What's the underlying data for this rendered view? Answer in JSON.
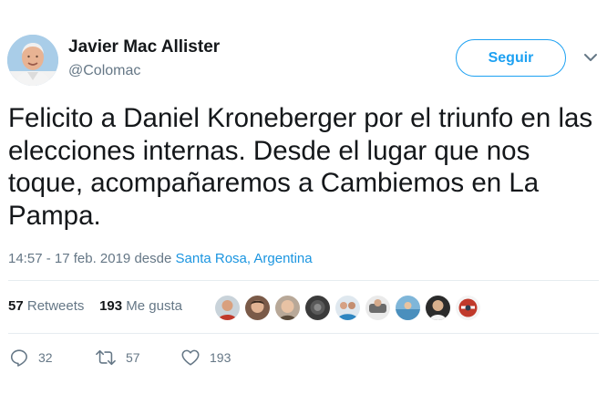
{
  "tweet": {
    "author_name": "Javier Mac Allister",
    "author_handle": "@Colomac",
    "follow_label": "Seguir",
    "text": "Felicito a Daniel Kroneberger por el triunfo en las elecciones internas. Desde el lugar que nos toque, acompañaremos a Cambiemos en La Pampa.",
    "timestamp": "14:57 - 17 feb. 2019",
    "from_word": "desde",
    "location": "Santa Rosa, Argentina"
  },
  "stats": {
    "retweets_count": "57",
    "retweets_label": "Retweets",
    "likes_count": "193",
    "likes_label": "Me gusta"
  },
  "actions": {
    "reply_count": "32",
    "retweet_count": "57",
    "like_count": "193"
  },
  "colors": {
    "accent": "#1da1f2",
    "link": "#1b95e0",
    "muted_text": "#657786",
    "primary_text": "#14171a",
    "divider": "#e6ecf0"
  },
  "icons": {
    "reply": "reply-icon",
    "retweet": "retweet-icon",
    "like": "heart-icon",
    "menu": "chevron-down-icon"
  }
}
